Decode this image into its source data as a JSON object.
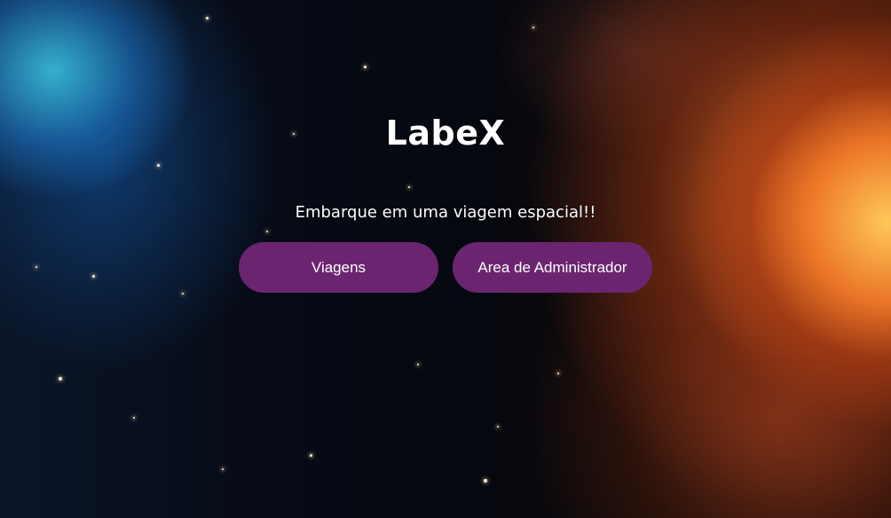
{
  "hero": {
    "title": "LabeX",
    "subtitle": "Embarque em uma viagem espacial!!"
  },
  "actions": {
    "trips_label": "Viagens",
    "admin_label": "Area de Administrador"
  },
  "colors": {
    "button_background": "#6b2570",
    "text": "#ffffff"
  }
}
